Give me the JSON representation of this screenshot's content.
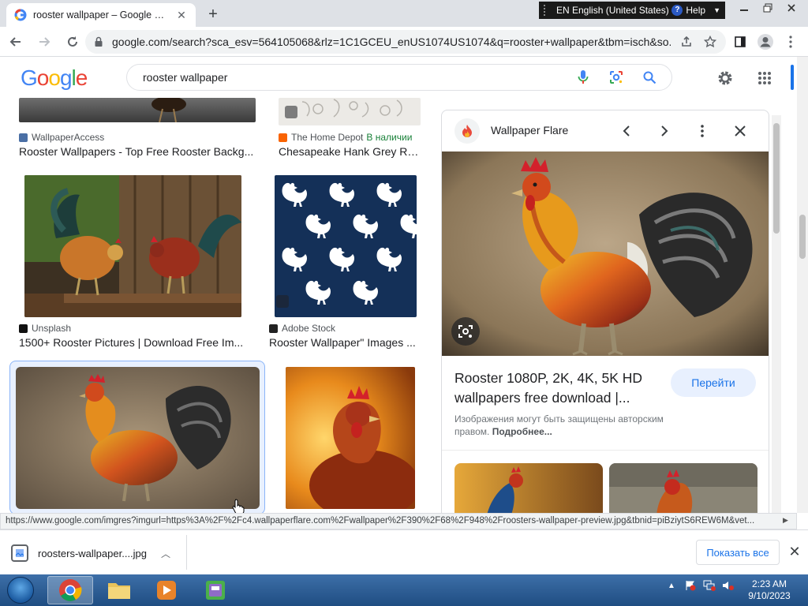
{
  "browser": {
    "tab": {
      "title": "rooster wallpaper – Google Поис"
    },
    "language_bar": {
      "language": "EN English (United States)",
      "help": "Help"
    },
    "url": "google.com/search?sca_esv=564105068&rlz=1C1GCEU_enUS1074US1074&q=rooster+wallpaper&tbm=isch&so..."
  },
  "google": {
    "logo_letters": [
      "G",
      "o",
      "o",
      "g",
      "l",
      "e"
    ],
    "logo_colors": [
      "#4285f4",
      "#ea4335",
      "#fbbc05",
      "#4285f4",
      "#34a853",
      "#ea4335"
    ],
    "query": "rooster wallpaper"
  },
  "results": [
    {
      "source": "WallpaperAccess",
      "title": "Rooster Wallpapers - Top Free Rooster Backg...",
      "stock": ""
    },
    {
      "source": "The Home Depot",
      "stock": "В наличии",
      "title": "Chesapeake Hank Grey Ro..."
    },
    {
      "source": "Unsplash",
      "title": "1500+ Rooster Pictures | Download Free Im...",
      "stock": ""
    },
    {
      "source": "Adobe Stock",
      "title": "Rooster Wallpaper\" Images ...",
      "stock": ""
    }
  ],
  "panel": {
    "site": "Wallpaper Flare",
    "title": "Rooster 1080P, 2K, 4K, 5K HD wallpapers free download |...",
    "visit_label": "Перейти",
    "copyright": "Изображения могут быть защищены авторским правом.",
    "learn_more": "Подробнее..."
  },
  "status_url": "https://www.google.com/imgres?imgurl=https%3A%2F%2Fc4.wallpaperflare.com%2Fwallpaper%2F390%2F68%2F948%2Froosters-wallpaper-preview.jpg&tbnid=piBziytS6REW6M&vet...",
  "download": {
    "filename": "roosters-wallpaper....jpg",
    "show_all": "Показать все"
  },
  "taskbar": {
    "time": "2:23 AM",
    "date": "9/10/2023"
  },
  "colors": {
    "accent": "#1a73e8",
    "stock_green": "#188038"
  }
}
